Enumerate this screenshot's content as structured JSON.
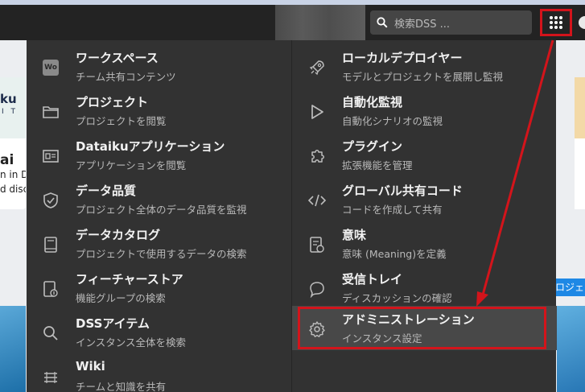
{
  "header": {
    "search_placeholder": "検索DSS ..."
  },
  "background": {
    "card_left_logo_top": "ku",
    "card_left_logo_bottom": "I T",
    "card_left_title": "ai",
    "card_left_line1": "n in Du",
    "card_left_line2": "d disco",
    "right_button_label": "ロジェク"
  },
  "menu": {
    "left": [
      {
        "title": "ワークスペース",
        "sub": "チーム共有コンテンツ",
        "icon": "workspace-badge-icon",
        "badge": "Wo"
      },
      {
        "title": "プロジェクト",
        "sub": "プロジェクトを閲覧",
        "icon": "folder-icon"
      },
      {
        "title": "Dataikuアプリケーション",
        "sub": "アプリケーションを閲覧",
        "icon": "application-icon"
      },
      {
        "title": "データ品質",
        "sub": "プロジェクト全体のデータ品質を監視",
        "icon": "shield-check-icon"
      },
      {
        "title": "データカタログ",
        "sub": "プロジェクトで使用するデータの検索",
        "icon": "book-icon"
      },
      {
        "title": "フィーチャーストア",
        "sub": "機能グループの検索",
        "icon": "feature-store-icon"
      },
      {
        "title": "DSSアイテム",
        "sub": "インスタンス全体を検索",
        "icon": "search-icon"
      },
      {
        "title": "Wiki",
        "sub": "チームと知識を共有",
        "icon": "wiki-icon"
      }
    ],
    "right": [
      {
        "title": "ローカルデプロイヤー",
        "sub": "モデルとプロジェクトを展開し監視",
        "icon": "rocket-icon"
      },
      {
        "title": "自動化監視",
        "sub": "自動化シナリオの監視",
        "icon": "play-icon"
      },
      {
        "title": "プラグイン",
        "sub": "拡張機能を管理",
        "icon": "puzzle-icon"
      },
      {
        "title": "グローバル共有コード",
        "sub": "コードを作成して共有",
        "icon": "code-icon"
      },
      {
        "title": "意味",
        "sub": "意味 (Meaning)を定義",
        "icon": "meaning-icon"
      },
      {
        "title": "受信トレイ",
        "sub": "ディスカッションの確認",
        "icon": "chat-icon"
      },
      {
        "title": "アドミニストレーション",
        "sub": "インスタンス設定",
        "icon": "gear-icon"
      }
    ]
  },
  "colors": {
    "menu_bg": "#323232",
    "header_bg": "#232323",
    "highlight": "#d3141b",
    "active_row": "#484848"
  }
}
